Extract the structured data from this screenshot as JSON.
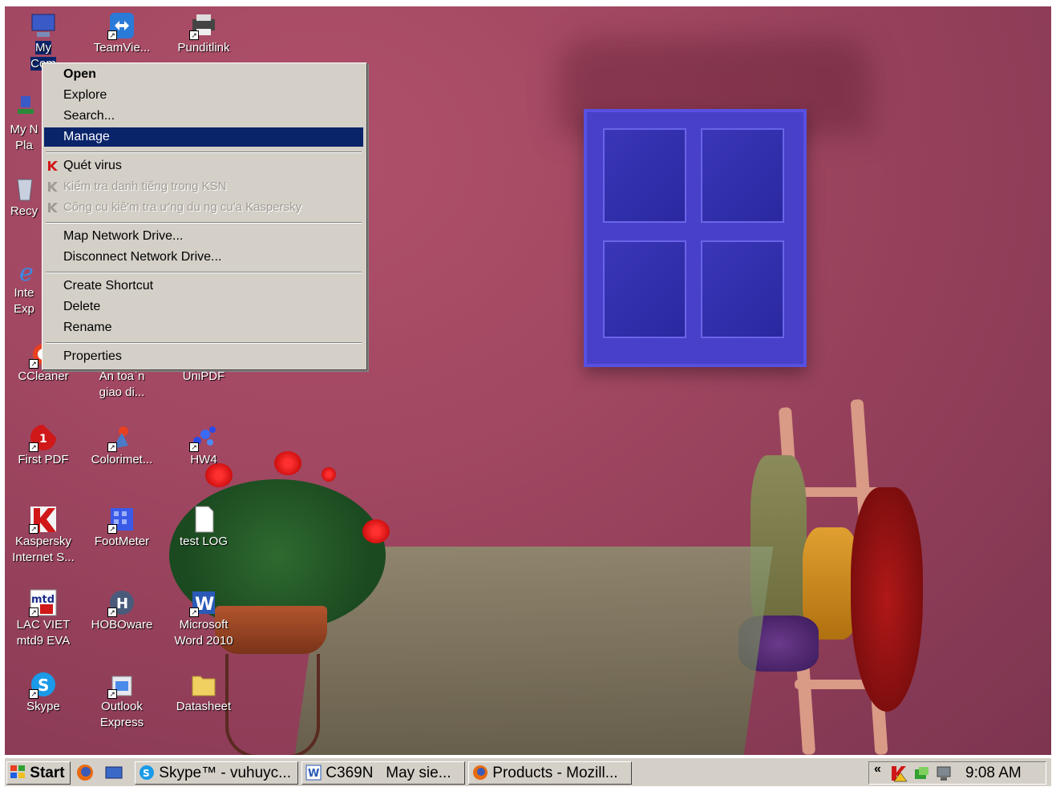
{
  "desktop_icons": [
    {
      "label": "My\nCom",
      "icon": "my-computer-icon"
    },
    {
      "label": "TeamVie...",
      "icon": "teamviewer-icon"
    },
    {
      "label": "Punditlink",
      "icon": "printer-icon"
    },
    {
      "label": "My N\nPla",
      "icon": "network-places-icon"
    },
    {
      "label": "Recy",
      "icon": "recycle-bin-icon"
    },
    {
      "label": "Inte\nExp",
      "icon": "internet-explorer-icon"
    },
    {
      "label": "CCleaner",
      "icon": "ccleaner-icon"
    },
    {
      "label": "An toa`n\ngiao di...",
      "icon": "safe-transaction-icon"
    },
    {
      "label": "UniPDF",
      "icon": "unipdf-icon"
    },
    {
      "label": "First PDF",
      "icon": "first-pdf-icon"
    },
    {
      "label": "Colorimet...",
      "icon": "colorimeter-icon"
    },
    {
      "label": "HW4",
      "icon": "hw4-icon"
    },
    {
      "label": "Kaspersky\nInternet S...",
      "icon": "kaspersky-icon"
    },
    {
      "label": "FootMeter",
      "icon": "footmeter-icon"
    },
    {
      "label": "test LOG",
      "icon": "text-file-icon"
    },
    {
      "label": "LAC VIET\nmtd9 EVA",
      "icon": "lacviet-icon"
    },
    {
      "label": "HOBOware",
      "icon": "hoboware-icon"
    },
    {
      "label": "Microsoft\nWord 2010",
      "icon": "word-icon"
    },
    {
      "label": "Skype",
      "icon": "skype-icon"
    },
    {
      "label": "Outlook\nExpress",
      "icon": "outlook-express-icon"
    },
    {
      "label": "Datasheet",
      "icon": "folder-icon"
    }
  ],
  "context_menu": {
    "open": "Open",
    "explore": "Explore",
    "search": "Search...",
    "manage": "Manage",
    "scan_virus": "Quét virus",
    "check_ksn": "Kiểm tra danh tiếng trong KSN",
    "kaspersky_tool": "Công cụ kiê'm tra ư'ng du ng cu'a Kaspersky",
    "map_drive": "Map Network Drive...",
    "disconnect_drive": "Disconnect Network Drive...",
    "create_shortcut": "Create Shortcut",
    "delete": "Delete",
    "rename": "Rename",
    "properties": "Properties"
  },
  "taskbar": {
    "start": "Start",
    "tasks": [
      {
        "label": "Skype™ - vuhuyc..."
      },
      {
        "label": "C369N   May sie..."
      },
      {
        "label": "Products - Mozill..."
      }
    ],
    "tray_expand": "«",
    "clock": "9:08 AM"
  },
  "colors": {
    "menu_highlight": "#0a246a",
    "menu_background": "#d4d0c8",
    "wall": "#a24862",
    "window": "#4840c8"
  }
}
